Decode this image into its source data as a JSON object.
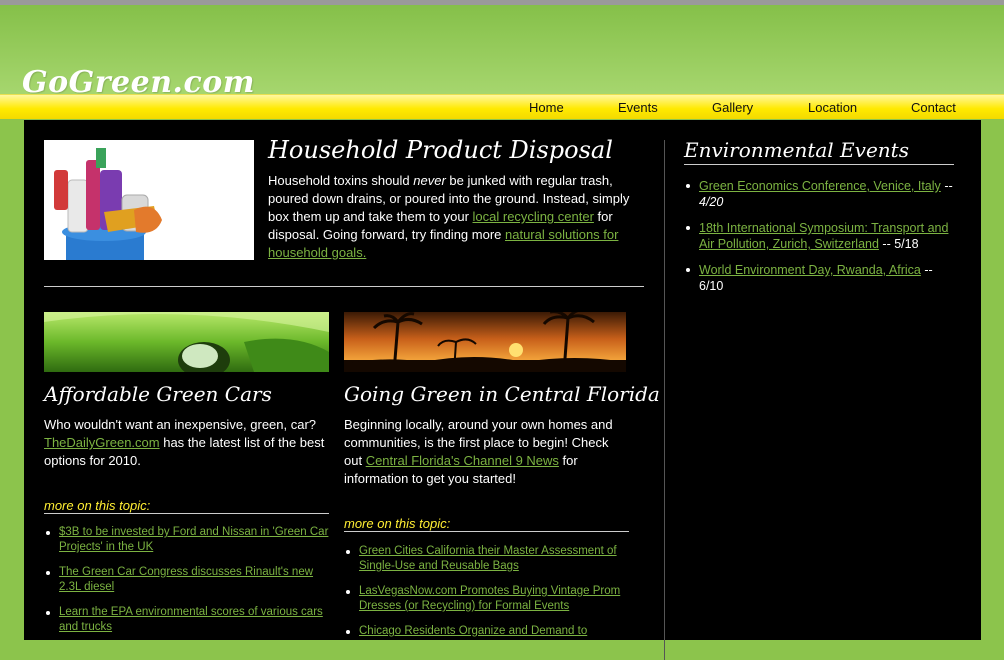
{
  "site": {
    "logo": "GoGreen.com"
  },
  "nav": [
    {
      "label": "Home"
    },
    {
      "label": "Events"
    },
    {
      "label": "Gallery"
    },
    {
      "label": "Location"
    },
    {
      "label": "Contact"
    }
  ],
  "feature": {
    "title": "Household Product Disposal",
    "text_a": "Household toxins should ",
    "text_em": "never",
    "text_b": " be junked with regular trash, poured down drains, or poured into the ground. Instead, simply box them up and take them to your ",
    "link1": "local recycling center",
    "text_c": " for disposal. Going forward, try finding more ",
    "link2": "natural solutions for household goals."
  },
  "cards": [
    {
      "title": "Affordable Green Cars",
      "text_a": "Who wouldn't want an inexpensive, green, car? ",
      "link": "TheDailyGreen.com",
      "text_b": " has the latest list of the best options for 2010.",
      "more_label": "more on this topic:",
      "more": [
        "$3B to be invested by Ford and Nissan in 'Green Car Projects' in the UK",
        "The Green Car Congress discusses Rinault's new 2.3L diesel",
        "Learn the EPA environmental scores of various cars and trucks"
      ]
    },
    {
      "title": "Going Green in Central Florida",
      "text_a": "Beginning locally, around your own homes and communities, is the first place to begin! Check out ",
      "link": "Central Florida's Channel 9 News",
      "text_b": " for information to get you started!",
      "more_label": "more on this topic:",
      "more": [
        "Green Cities California their Master Assessment of Single-Use and Reusable Bags",
        "LasVegasNow.com Promotes Buying Vintage Prom Dresses (or Recycling) for Formal Events",
        "Chicago Residents Organize and Demand to"
      ]
    }
  ],
  "sidebar": {
    "title": "Environmental Events",
    "events": [
      {
        "link": "Green Economics Conference, Venice, Italy",
        "date": " -- 4/20"
      },
      {
        "link": "18th International Symposium: Transport and Air Pollution, Zurich, Switzerland",
        "date": " -- 5/18"
      },
      {
        "link": "World Environment Day, Rwanda, Africa",
        "date": " -- 6/10"
      }
    ]
  },
  "colors": {
    "header_green": "#8cc44c",
    "nav_yellow": "#ffea00",
    "link_green": "#7cb342",
    "more_yellow": "#ffee33",
    "content_bg": "#000000"
  }
}
